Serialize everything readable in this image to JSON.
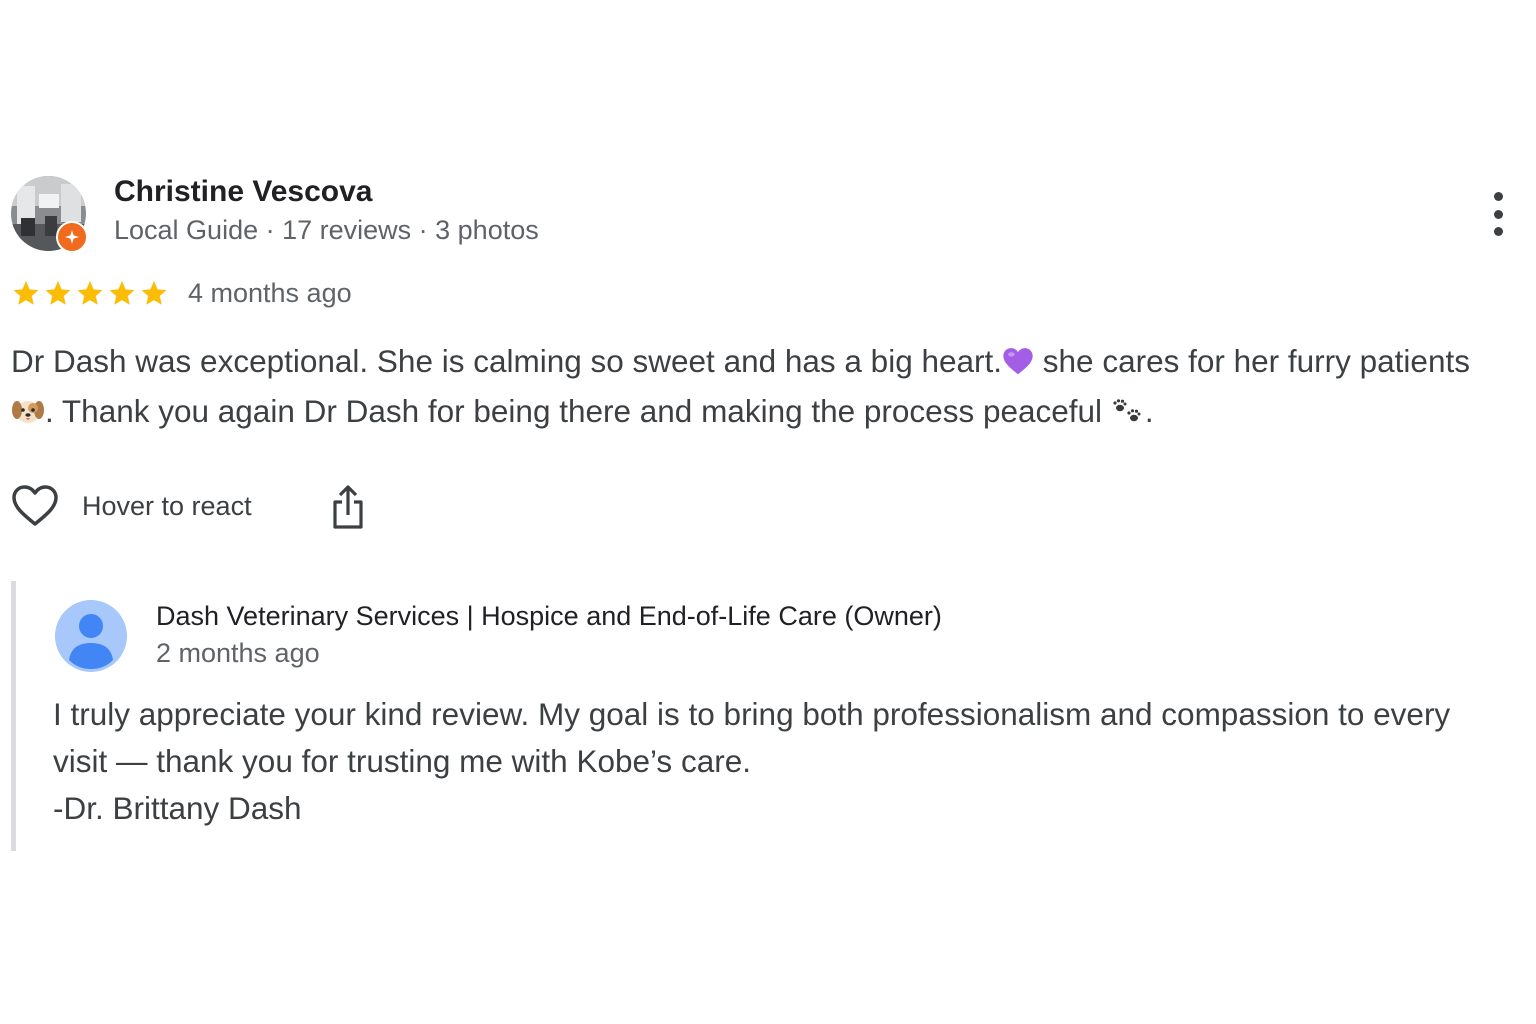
{
  "review": {
    "reviewer": {
      "name": "Christine Vescova",
      "meta": "Local Guide · 17 reviews · 3 photos",
      "badge_color": "#f06b1d"
    },
    "rating": {
      "stars": 5,
      "max": 5,
      "star_color": "#fbbc04"
    },
    "time": "4 months ago",
    "text": {
      "line1_part1": "Dr Dash was exceptional. She is calming so sweet and has a big heart.",
      "line1_emoji": "💜",
      "line1_part2": " she cares for her furry patients",
      "line2_emoji": "🐶",
      "line2_part1": ". Thank you again Dr Dash for being there and making the process peaceful ",
      "line2_emoji2": "🐾",
      "line2_part2": "."
    },
    "actions": {
      "react_label": "Hover to react",
      "react_icon": "heart-outline-icon",
      "share_icon": "share-icon",
      "more_icon": "more-vertical-icon"
    }
  },
  "owner_reply": {
    "name": "Dash Veterinary Services | Hospice and End-of-Life Care (Owner)",
    "time": "2 months ago",
    "lines": [
      "I truly appreciate your kind review. My goal is to bring both professionalism and compassion to every",
      "visit — thank you for trusting me with Kobe’s care.",
      "-Dr. Brittany Dash"
    ],
    "avatar_color": "#a8c7fa",
    "avatar_fg_color": "#4285f4"
  }
}
